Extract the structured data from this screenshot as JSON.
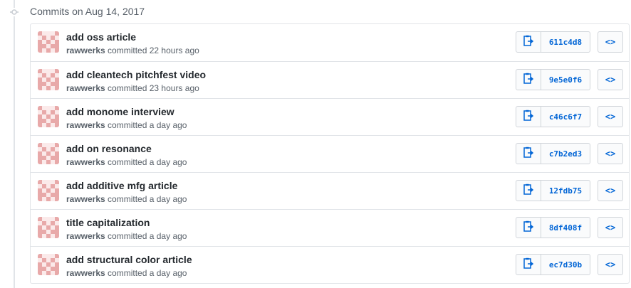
{
  "group": {
    "title": "Commits on Aug 14, 2017"
  },
  "commits": [
    {
      "title": "add oss article",
      "author": "rawwerks",
      "action": "committed",
      "time": "22 hours ago",
      "sha": "611c4d8",
      "browse": "<>"
    },
    {
      "title": "add cleantech pitchfest video",
      "author": "rawwerks",
      "action": "committed",
      "time": "23 hours ago",
      "sha": "9e5e0f6",
      "browse": "<>"
    },
    {
      "title": "add monome interview",
      "author": "rawwerks",
      "action": "committed",
      "time": "a day ago",
      "sha": "c46c6f7",
      "browse": "<>"
    },
    {
      "title": "add on resonance",
      "author": "rawwerks",
      "action": "committed",
      "time": "a day ago",
      "sha": "c7b2ed3",
      "browse": "<>"
    },
    {
      "title": "add additive mfg article",
      "author": "rawwerks",
      "action": "committed",
      "time": "a day ago",
      "sha": "12fdb75",
      "browse": "<>"
    },
    {
      "title": "title capitalization",
      "author": "rawwerks",
      "action": "committed",
      "time": "a day ago",
      "sha": "8df408f",
      "browse": "<>"
    },
    {
      "title": "add structural color article",
      "author": "rawwerks",
      "action": "committed",
      "time": "a day ago",
      "sha": "ec7d30b",
      "browse": "<>"
    }
  ],
  "icons": {
    "timeline": "git-commit-icon",
    "copy": "clippy-icon",
    "avatar": "identicon-avatar"
  },
  "colors": {
    "link": "#0366d6",
    "avatar_fill": "#e8a9a9",
    "border": "#e1e4e8"
  }
}
